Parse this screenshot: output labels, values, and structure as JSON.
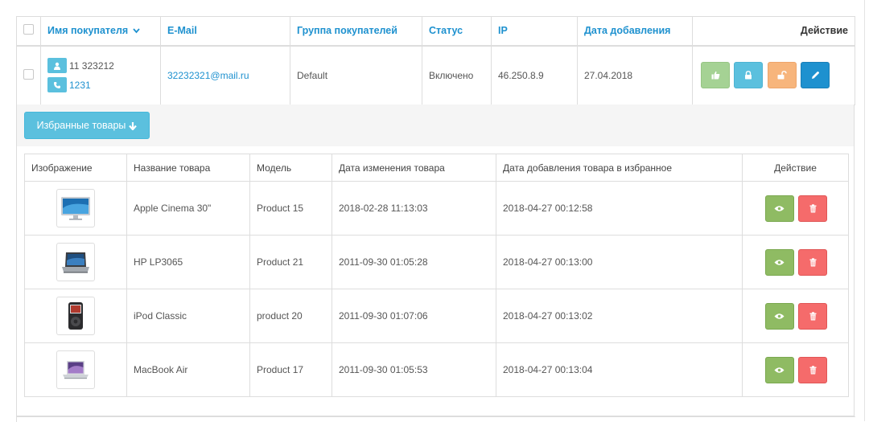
{
  "customers_table": {
    "headers": {
      "name": "Имя покупателя",
      "email": "E-Mail",
      "group": "Группа покупателей",
      "status": "Статус",
      "ip": "IP",
      "date_added": "Дата добавления",
      "action": "Действие"
    },
    "row": {
      "name": "11 323212",
      "phone": "1231",
      "email": "32232321@mail.ru",
      "group": "Default",
      "status": "Включено",
      "ip": "46.250.8.9",
      "date_added": "27.04.2018"
    }
  },
  "wishlist": {
    "button_label": "Избранные товары",
    "headers": {
      "image": "Изображение",
      "name": "Название товара",
      "model": "Модель",
      "modified": "Дата изменения товара",
      "added": "Дата добавления товара в избранное",
      "action": "Действие"
    },
    "items": [
      {
        "name": "Apple Cinema 30\"",
        "model": "Product 15",
        "modified": "2018-02-28 11:13:03",
        "added": "2018-04-27 00:12:58",
        "image_icon": "monitor-thumbnail"
      },
      {
        "name": "HP LP3065",
        "model": "Product 21",
        "modified": "2011-09-30 01:05:28",
        "added": "2018-04-27 00:13:00",
        "image_icon": "laptop-thumbnail"
      },
      {
        "name": "iPod Classic",
        "model": "product 20",
        "modified": "2011-09-30 01:07:06",
        "added": "2018-04-27 00:13:02",
        "image_icon": "ipod-thumbnail"
      },
      {
        "name": "MacBook Air",
        "model": "Product 17",
        "modified": "2011-09-30 01:05:53",
        "added": "2018-04-27 00:13:04",
        "image_icon": "macbook-thumbnail"
      }
    ]
  },
  "colors": {
    "link": "#1e91cf",
    "info": "#5bc0de",
    "success": "#8fbb63",
    "danger": "#f56b6b",
    "warning": "#f7b57c",
    "primary": "#1e91cf"
  }
}
